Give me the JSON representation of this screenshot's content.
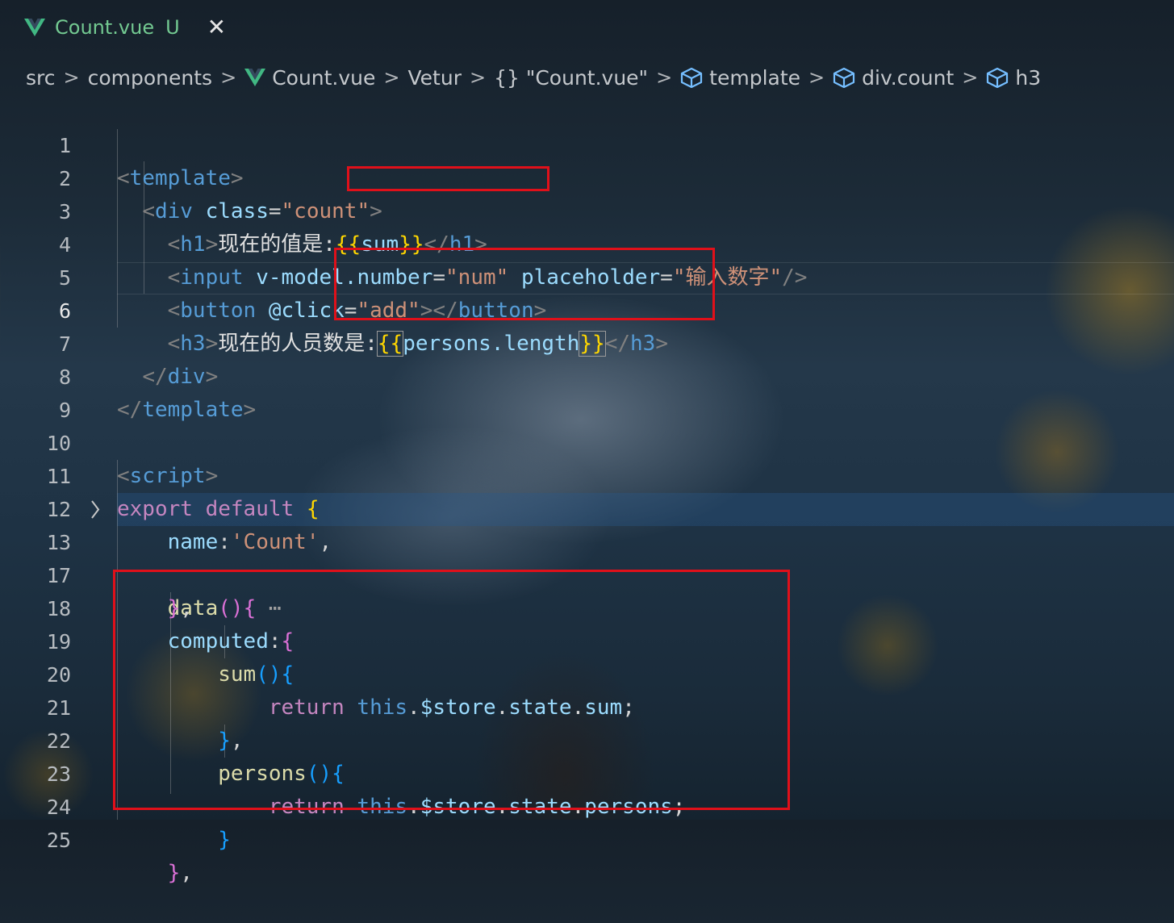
{
  "tab": {
    "title": "Count.vue",
    "badge": "U",
    "close": "✕"
  },
  "breadcrumb": {
    "items": [
      "src",
      "components",
      "Count.vue",
      "Vetur",
      "{} \"Count.vue\"",
      "template",
      "div.count",
      "h3"
    ],
    "separator": ">"
  },
  "lines": {
    "n1": "1",
    "n2": "2",
    "n3": "3",
    "n4": "4",
    "n5": "5",
    "n6": "6",
    "n7": "7",
    "n8": "8",
    "n9": "9",
    "n10": "10",
    "n11": "11",
    "n12": "12",
    "n13": "13",
    "n17": "17",
    "n18": "18",
    "n19": "19",
    "n20": "20",
    "n21": "21",
    "n22": "22",
    "n23": "23",
    "n24": "24",
    "n25": "25"
  },
  "code": {
    "template": "template",
    "div": "div",
    "class_attr": "class",
    "class_val": "\"count\"",
    "h1": "h1",
    "h1_text": "现在的值是:",
    "sum": "sum",
    "input": "input",
    "vmodel": "v-model.number",
    "num_val": "\"num\"",
    "placeholder_attr": "placeholder",
    "placeholder_val": "\"输入数字\"",
    "button": "button",
    "click_attr": "@click",
    "add_val": "\"add\"",
    "h3": "h3",
    "h3_text": "现在的人员数是:",
    "persons_length": "persons.length",
    "script": "script",
    "export": "export",
    "default": "default",
    "name_key": "name",
    "name_val": "'Count'",
    "data": "data",
    "computed": "computed",
    "return": "return",
    "this": "this",
    "store": "$store",
    "state": "state",
    "persons": "persons",
    "ellipsis": "⋯"
  },
  "colors": {
    "accent_box": "#e0101a",
    "vue_green": "#41b883",
    "vue_dark": "#35495e",
    "tab_modified": "#73c991"
  },
  "icons": [
    "vue-logo-icon",
    "close-icon",
    "chevron-right-icon",
    "cube-icon",
    "fold-chevron-icon"
  ]
}
